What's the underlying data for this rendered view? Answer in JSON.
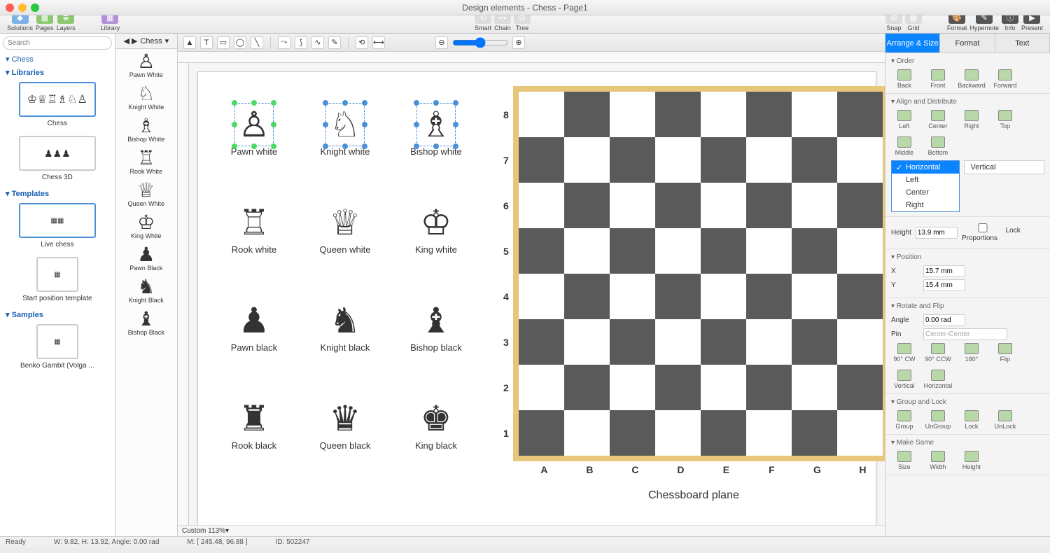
{
  "window": {
    "title": "Design elements - Chess - Page1"
  },
  "mainbar": {
    "left": [
      {
        "label": "Solutions"
      },
      {
        "label": "Pages"
      },
      {
        "label": "Layers"
      }
    ],
    "library": {
      "label": "Library"
    },
    "center": [
      {
        "label": "Smart"
      },
      {
        "label": "Chain"
      },
      {
        "label": "Tree"
      }
    ],
    "right": [
      {
        "label": "Snap"
      },
      {
        "label": "Grid"
      }
    ],
    "far": [
      {
        "label": "Format"
      },
      {
        "label": "Hypernote"
      },
      {
        "label": "Info"
      },
      {
        "label": "Present"
      }
    ]
  },
  "left": {
    "search_placeholder": "Search",
    "tree_root": "Chess",
    "s_libraries": "Libraries",
    "s_templates": "Templates",
    "s_samples": "Samples",
    "items": {
      "chess": "Chess",
      "chess3d": "Chess 3D",
      "live": "Live chess",
      "start": "Start position template",
      "benko": "Benko Gambit (Volga ..."
    }
  },
  "shapes": {
    "header": "Chess",
    "list": [
      {
        "glyph": "♙",
        "label": "Pawn White"
      },
      {
        "glyph": "♘",
        "label": "Knight White"
      },
      {
        "glyph": "♗",
        "label": "Bishop White"
      },
      {
        "glyph": "♖",
        "label": "Rook White"
      },
      {
        "glyph": "♕",
        "label": "Queen White"
      },
      {
        "glyph": "♔",
        "label": "King White"
      },
      {
        "glyph": "♟",
        "label": "Pawn Black"
      },
      {
        "glyph": "♞",
        "label": "Knight Black"
      },
      {
        "glyph": "♝",
        "label": "Bishop Black"
      }
    ]
  },
  "canvas": {
    "pieces": [
      {
        "glyph": "♙",
        "label": "Pawn white",
        "sel": "g"
      },
      {
        "glyph": "♘",
        "label": "Knight white",
        "sel": "b"
      },
      {
        "glyph": "♗",
        "label": "Bishop white",
        "sel": "b"
      },
      {
        "glyph": "♖",
        "label": "Rook white"
      },
      {
        "glyph": "♕",
        "label": "Queen white"
      },
      {
        "glyph": "♔",
        "label": "King white"
      },
      {
        "glyph": "♟",
        "label": "Pawn black"
      },
      {
        "glyph": "♞",
        "label": "Knight black"
      },
      {
        "glyph": "♝",
        "label": "Bishop black"
      },
      {
        "glyph": "♜",
        "label": "Rook black"
      },
      {
        "glyph": "♛",
        "label": "Queen black"
      },
      {
        "glyph": "♚",
        "label": "King black"
      }
    ],
    "board_title": "Chessboard plane",
    "ranks": [
      "8",
      "7",
      "6",
      "5",
      "4",
      "3",
      "2",
      "1"
    ],
    "files": [
      "A",
      "B",
      "C",
      "D",
      "E",
      "F",
      "G",
      "H"
    ]
  },
  "right": {
    "tabs": {
      "arrange": "Arrange & Size",
      "format": "Format",
      "text": "Text"
    },
    "sections": {
      "order": {
        "title": "Order",
        "btns": [
          "Back",
          "Front",
          "Backward",
          "Forward"
        ]
      },
      "align": {
        "title": "Align and Distribute",
        "btns": [
          "Left",
          "Center",
          "Right",
          "Top",
          "Middle",
          "Bottom"
        ],
        "h_label": "Horizontal",
        "h_options": [
          "Horizontal",
          "Left",
          "Center",
          "Right"
        ],
        "v_label": "Vertical"
      },
      "size": {
        "height_lbl": "Height",
        "height_val": "13.9 mm",
        "lock": "Lock Proportions"
      },
      "position": {
        "title": "Position",
        "x_lbl": "X",
        "x_val": "15.7 mm",
        "y_lbl": "Y",
        "y_val": "15.4 mm"
      },
      "rotate": {
        "title": "Rotate and Flip",
        "angle_lbl": "Angle",
        "angle_val": "0.00 rad",
        "pin_lbl": "Pin",
        "pin_val": "Center-Center",
        "btns": [
          "90° CW",
          "90° CCW",
          "180°",
          "Flip",
          "Vertical",
          "Horizontal"
        ]
      },
      "group": {
        "title": "Group and Lock",
        "btns": [
          "Group",
          "UnGroup",
          "Lock",
          "UnLock"
        ]
      },
      "same": {
        "title": "Make Same",
        "btns": [
          "Size",
          "Width",
          "Height"
        ]
      }
    }
  },
  "zoom": {
    "label": "Custom 113%"
  },
  "status": {
    "ready": "Ready",
    "wh": "W: 9.82,  H: 13.92,  Angle: 0.00 rad",
    "mouse": "M: [ 245.48, 96.88 ]",
    "id": "ID: 502247"
  }
}
